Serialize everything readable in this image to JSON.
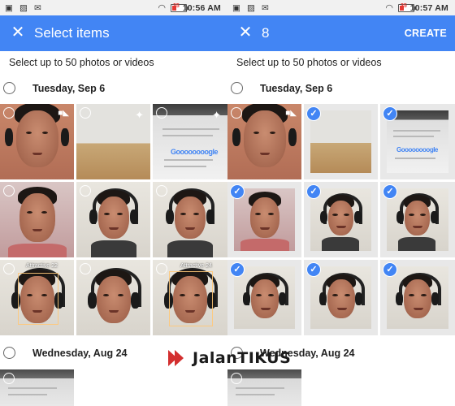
{
  "left": {
    "status": {
      "time": "10:56 AM",
      "battery": "35"
    },
    "appbar": {
      "title": "Select items"
    },
    "hint": "Select up to 50 photos or videos",
    "sections": [
      {
        "date": "Tuesday, Sep 6"
      },
      {
        "date": "Wednesday, Aug 24"
      }
    ],
    "tile_labels": {
      "attr1": "Attractive 22",
      "attr2": "Attractive 24"
    }
  },
  "right": {
    "status": {
      "time": "10:57 AM",
      "battery": "35"
    },
    "appbar": {
      "count": "8",
      "create_label": "CREATE"
    },
    "hint": "Select up to 50 photos or videos",
    "sections": [
      {
        "date": "Tuesday, Sep 6"
      },
      {
        "date": "Wednesday, Aug 24"
      }
    ]
  },
  "watermark": {
    "text": "JalanTIKUS"
  },
  "icons": {
    "close": "close-icon",
    "video": "video-icon",
    "sparkle": "auto-enhance-icon",
    "check": "checkmark-icon"
  },
  "colors": {
    "accent": "#4285f4",
    "statusbar": "#f1f1f1"
  }
}
